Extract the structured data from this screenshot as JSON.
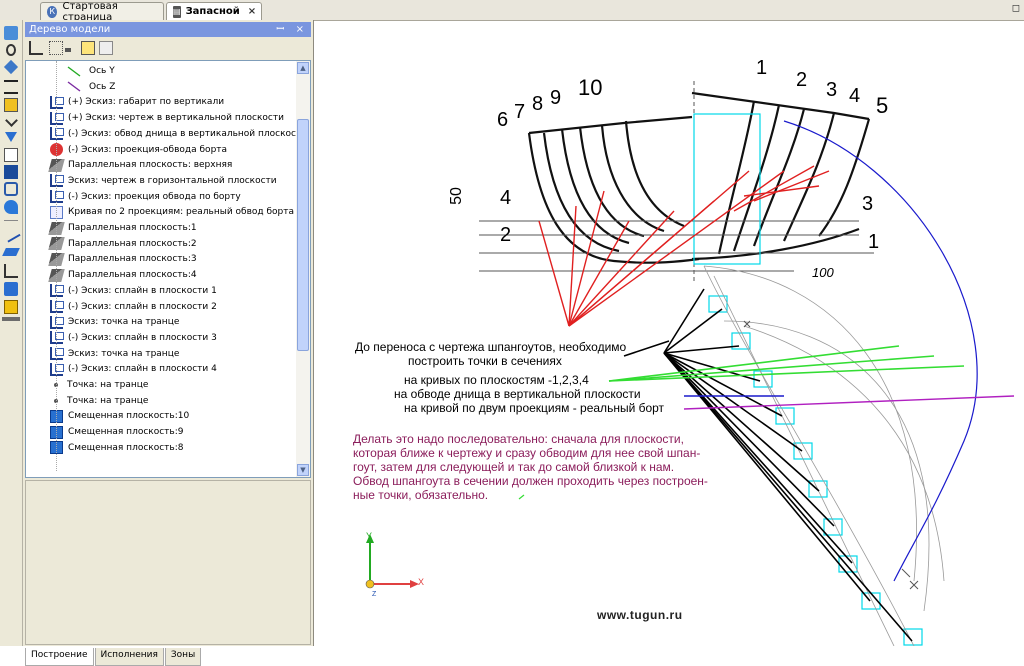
{
  "tabs": [
    {
      "label": "Стартовая страница",
      "icon": "home-icon",
      "active": false
    },
    {
      "label": "Запасной",
      "icon": "document-icon",
      "active": true
    }
  ],
  "tab_close": "×",
  "window_restore": "◻",
  "panel": {
    "title": "Дерево модели",
    "title_buttons": "ꟷ ×",
    "tree": [
      {
        "label": "Ось Y",
        "icon": "axis-y-icon"
      },
      {
        "label": "Ось Z",
        "icon": "axis-z-icon"
      },
      {
        "label": "(+) Эскиз: габарит по вертикали",
        "icon": "sketch-icon"
      },
      {
        "label": "(+) Эскиз: чертеж в вертикальной плоскости",
        "icon": "sketch-icon"
      },
      {
        "label": "(-) Эскиз: обвод днища в вертикальной плоскости",
        "icon": "sketch-icon"
      },
      {
        "label": "(-) Эскиз: проекция-обвода борта",
        "icon": "projection-icon"
      },
      {
        "label": "Параллельная плоскость: верхняя",
        "icon": "plane-icon"
      },
      {
        "label": "Эскиз: чертеж в горизонтальной плоскости",
        "icon": "sketch-icon"
      },
      {
        "label": "(-) Эскиз: проекция обвода по борту",
        "icon": "sketch-icon"
      },
      {
        "label": "Кривая по 2 проекциям: реальный обвод борта",
        "icon": "curve-icon"
      },
      {
        "label": "Параллельная плоскость:1",
        "icon": "plane-icon"
      },
      {
        "label": "Параллельная плоскость:2",
        "icon": "plane-icon"
      },
      {
        "label": "Параллельная плоскость:3",
        "icon": "plane-icon"
      },
      {
        "label": "Параллельная плоскость:4",
        "icon": "plane-icon"
      },
      {
        "label": "(-) Эскиз: сплайн в плоскости 1",
        "icon": "sketch-icon"
      },
      {
        "label": "(-) Эскиз: сплайн в плоскости 2",
        "icon": "sketch-icon"
      },
      {
        "label": "Эскиз: точка на транце",
        "icon": "sketch-icon"
      },
      {
        "label": "(-) Эскиз: сплайн в плоскости 3",
        "icon": "sketch-icon"
      },
      {
        "label": "Эскиз: точка на транце",
        "icon": "sketch-icon"
      },
      {
        "label": "(-) Эскиз: сплайн  в плоскости 4",
        "icon": "sketch-icon"
      },
      {
        "label": "Точка: на транце",
        "icon": "point-icon"
      },
      {
        "label": "Точка: на транце",
        "icon": "point-icon"
      },
      {
        "label": "Смещенная плоскость:10",
        "icon": "offset-plane-icon"
      },
      {
        "label": "Смещенная плоскость:9",
        "icon": "offset-plane-icon"
      },
      {
        "label": "Смещенная плоскость:8",
        "icon": "offset-plane-icon"
      }
    ],
    "bottom_tabs": [
      "Построение",
      "Исполнения",
      "Зоны"
    ]
  },
  "drawing": {
    "frame_numbers": [
      "6",
      "7",
      "8",
      "9",
      "10",
      "1",
      "2",
      "3",
      "4",
      "5"
    ],
    "waterline_labels": [
      "4",
      "2",
      "3",
      "1"
    ],
    "dim_50": "50",
    "dim_100": "100",
    "axis_x": "X",
    "axis_y": "Y",
    "axis_z": "Z"
  },
  "annotations": {
    "line1": "До переноса с чертежа шпангоутов, необходимо",
    "line2": "построить точки в сечениях",
    "line3": "на кривых по плоскостям -1,2,3,4",
    "line4": "на обводе днища в вертикальной плоскости",
    "line5": "на кривой по двум проекциям - реальный борт",
    "note1": "Делать это надо последовательно: сначала для плоскости,",
    "note2": "которая ближе к чертежу и сразу обводим для нее свой шпан-",
    "note3": "гоут, затем для следующей и так до самой близкой к нам.",
    "note4": " Обвод шпангоута в сечении должен проходить через построен-",
    "note5": "ные точки, обязательно."
  },
  "watermark": "www.tugun.ru",
  "colors": {
    "red": "#e02020",
    "green": "#33dd33",
    "blue": "#1a1acc",
    "violet": "#b020c0",
    "purple_text": "#8b1d5b",
    "cyan": "#00d8e8"
  }
}
